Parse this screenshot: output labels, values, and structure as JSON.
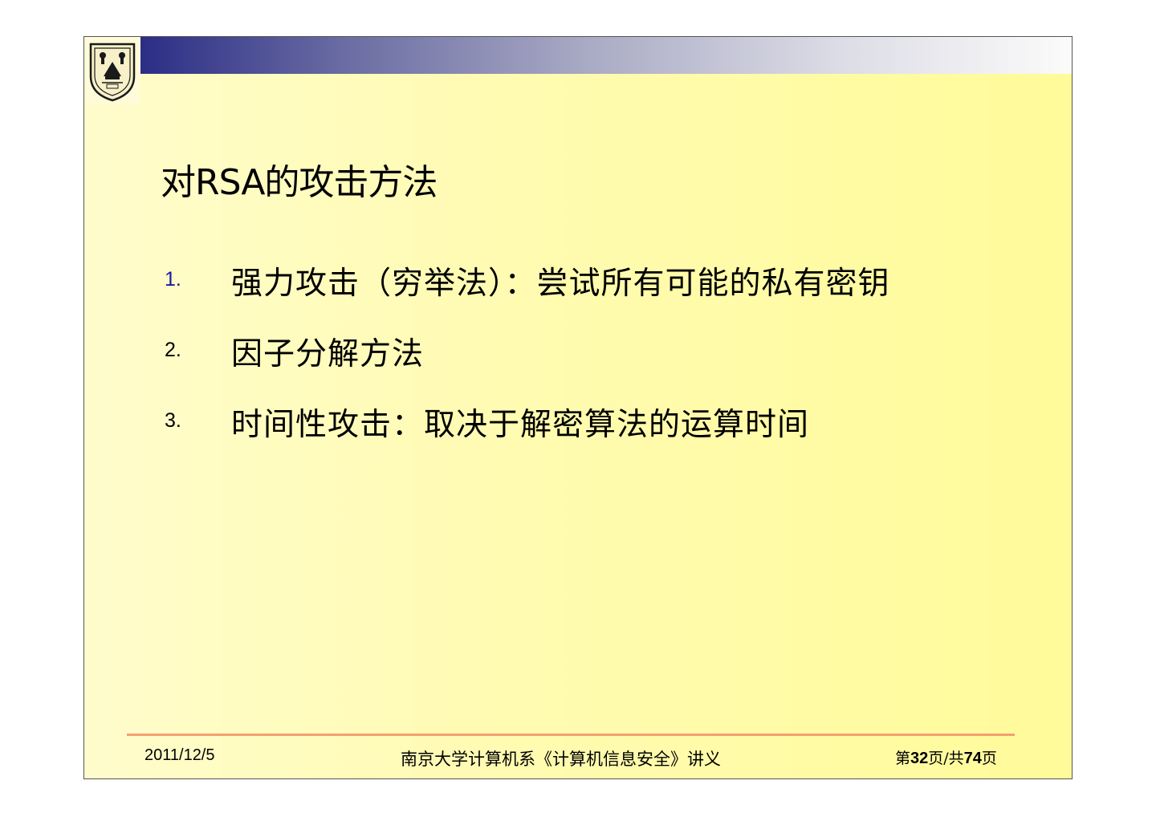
{
  "slide": {
    "title": "对RSA的攻击方法",
    "items": [
      {
        "number": "1.",
        "text": "强力攻击（穷举法）：尝试所有可能的私有密钥"
      },
      {
        "number": "2.",
        "text": "因子分解方法"
      },
      {
        "number": "3.",
        "text": "时间性攻击：取决于解密算法的运算时间"
      }
    ]
  },
  "logo": {
    "year": "1902",
    "text": "NANJING UNIVERSITY"
  },
  "footer": {
    "date": "2011/12/5",
    "course": "南京大学计算机系《计算机信息安全》讲义",
    "page_prefix": "第",
    "page_current": "32",
    "page_mid": "页/共",
    "page_total": "74",
    "page_suffix": "页"
  },
  "colors": {
    "number_accent": "#1a1a9c",
    "footer_line": "#f4a070",
    "band_dark": "#2b2d86"
  }
}
